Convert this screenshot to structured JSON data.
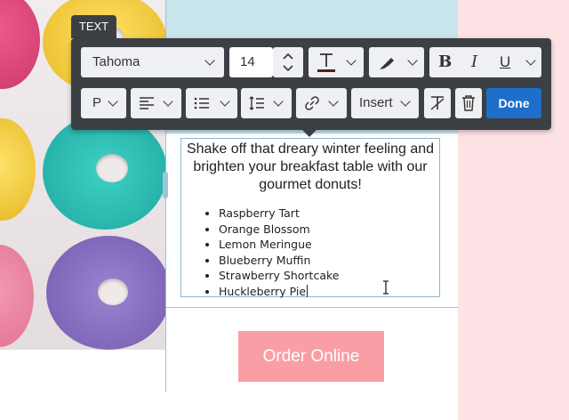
{
  "editor": {
    "element_tag": "TEXT",
    "toolbar": {
      "font_family": "Tahoma",
      "font_size": "14",
      "block_type": "P",
      "insert_label": "Insert",
      "done_label": "Done",
      "icons": [
        "text-color-icon",
        "highlight-icon",
        "bold-icon",
        "italic-icon",
        "underline-icon",
        "align-left-icon",
        "bullet-list-icon",
        "line-height-icon",
        "link-icon",
        "clear-format-icon",
        "delete-icon"
      ]
    }
  },
  "content": {
    "paragraph": "Shake off that dreary winter feeling and brighten your breakfast table with our gourmet donuts!",
    "list": [
      "Raspberry Tart",
      "Orange Blossom",
      "Lemon Meringue",
      "Blueberry Muffin",
      "Strawberry Shortcake",
      "Huckleberry Pie"
    ],
    "order_button": "Order Online"
  },
  "colors": {
    "toolbar_bg": "#3c4045",
    "done_button": "#1d6fcb",
    "order_button": "#fa9ea6",
    "center_top_bg": "#c7e5eb",
    "right_panel_bg": "#fde2e6"
  }
}
